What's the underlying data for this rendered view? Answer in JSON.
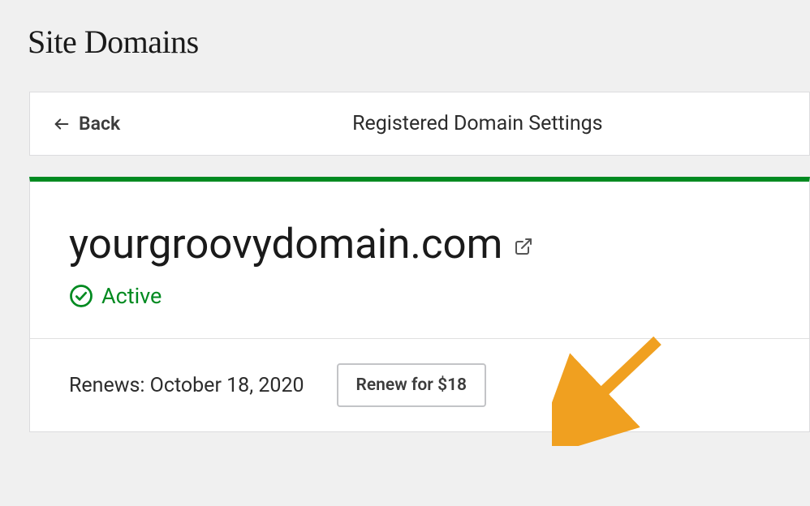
{
  "page": {
    "title": "Site Domains"
  },
  "panel": {
    "back_label": "Back",
    "header_title": "Registered Domain Settings"
  },
  "domain": {
    "name": "yourgroovydomain.com",
    "status": "Active",
    "renew_text": "Renews: October 18, 2020",
    "renew_button": "Renew for $18"
  }
}
